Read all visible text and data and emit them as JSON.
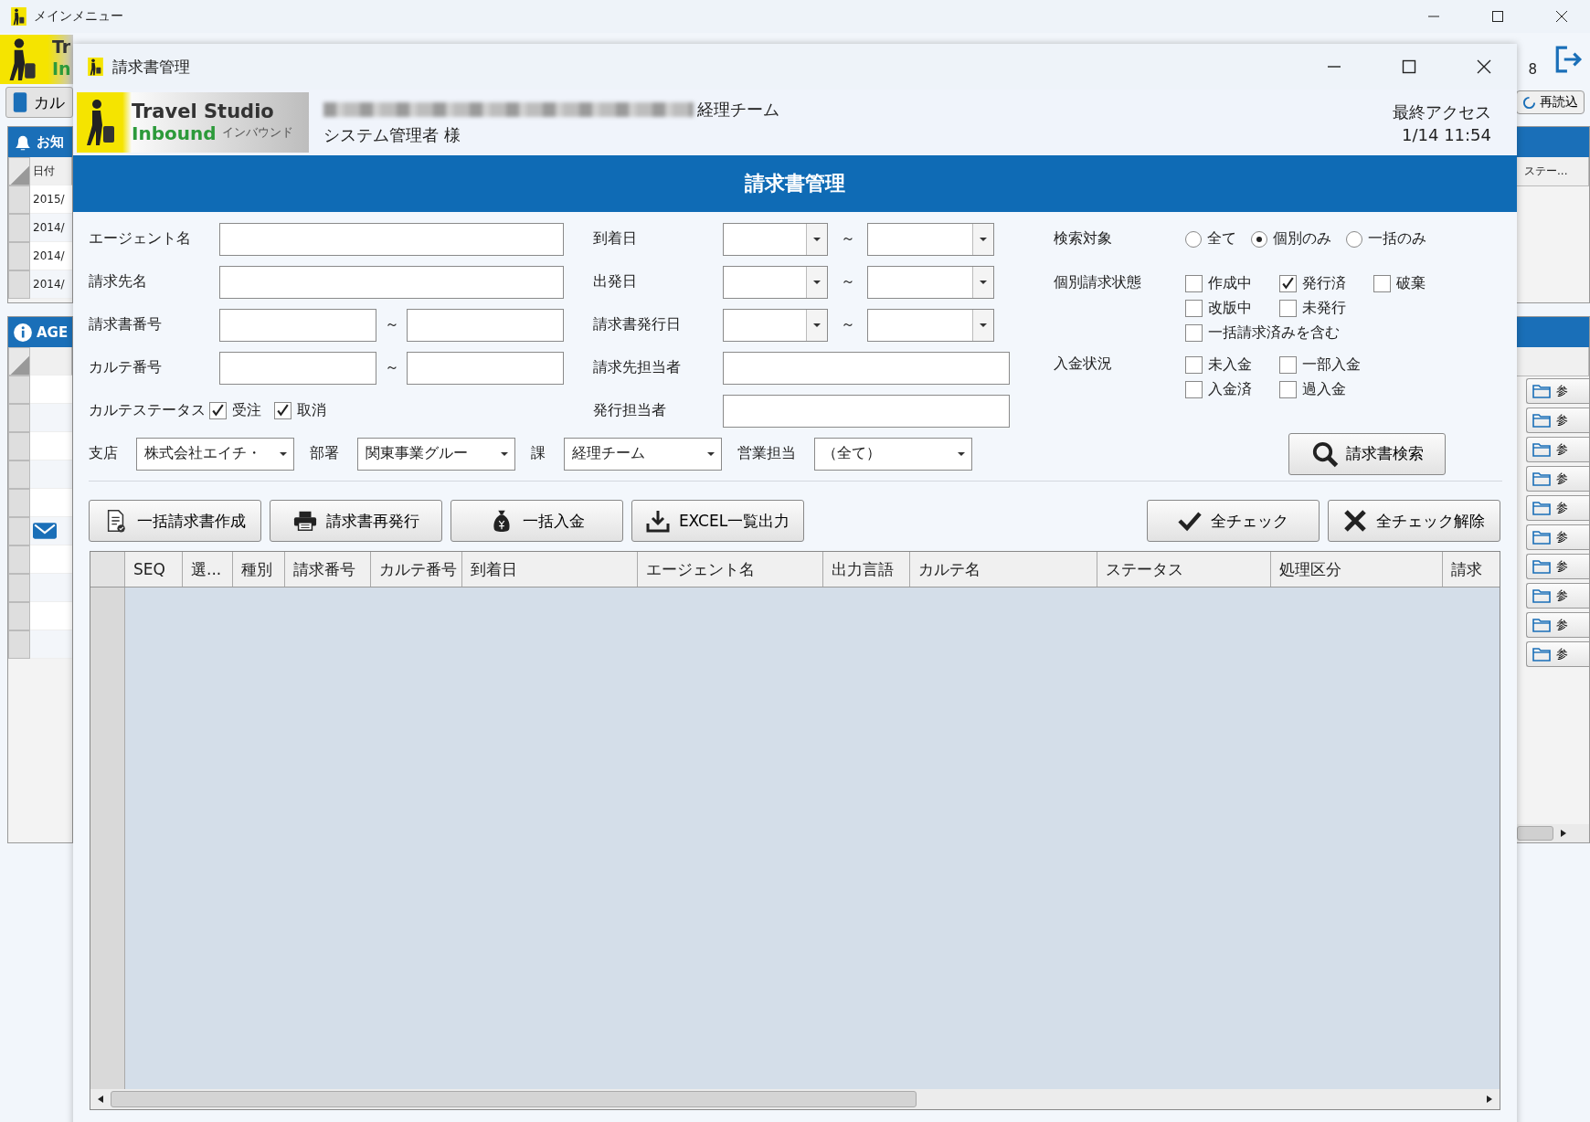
{
  "background_window": {
    "title": "メインメニュー",
    "logo_text": [
      "Tr",
      "In"
    ],
    "access_fragment": "8",
    "tab_button": "カル",
    "reload_button": "再読込",
    "notice_panel": {
      "title": "お知",
      "column": "日付",
      "rows": [
        "2015/",
        "2014/",
        "2014/",
        "2014/"
      ]
    },
    "agent_panel": {
      "title": "AGE",
      "rows": [
        {
          "has_mail": false
        },
        {
          "has_mail": false
        },
        {
          "has_mail": false
        },
        {
          "has_mail": false
        },
        {
          "has_mail": false
        },
        {
          "has_mail": true
        },
        {
          "has_mail": false
        },
        {
          "has_mail": false
        },
        {
          "has_mail": false
        },
        {
          "has_mail": false
        }
      ]
    },
    "status_column": "ステー...",
    "reference_buttons": [
      "参",
      "参",
      "参",
      "参",
      "参",
      "参",
      "参",
      "参",
      "参",
      "参"
    ]
  },
  "dialog": {
    "title": "請求書管理",
    "team": "経理チーム",
    "user": "システム管理者 様",
    "last_access_label": "最終アクセス",
    "last_access": "1/14 11:54",
    "logo": {
      "line1": "Travel Studio",
      "line2": "Inbound",
      "sub": "インバウンド"
    },
    "heading": "請求書管理",
    "left_fields": [
      {
        "label": "エージェント名",
        "kind": "text"
      },
      {
        "label": "請求先名",
        "kind": "text"
      },
      {
        "label": "請求書番号",
        "kind": "range",
        "separator": "～"
      },
      {
        "label": "カルテ番号",
        "kind": "range",
        "separator": "～"
      }
    ],
    "karte_status": {
      "label": "カルテステータス",
      "options": [
        {
          "label": "受注",
          "checked": true
        },
        {
          "label": "取消",
          "checked": true
        }
      ]
    },
    "mid_fields": [
      {
        "label": "到着日",
        "kind": "date_range",
        "separator": "～"
      },
      {
        "label": "出発日",
        "kind": "date_range",
        "separator": "～"
      },
      {
        "label": "請求書発行日",
        "kind": "date_range",
        "separator": "～"
      },
      {
        "label": "請求先担当者",
        "kind": "text"
      },
      {
        "label": "発行担当者",
        "kind": "text"
      }
    ],
    "search_target": {
      "label": "検索対象",
      "options": [
        {
          "label": "全て",
          "selected": false
        },
        {
          "label": "個別のみ",
          "selected": true
        },
        {
          "label": "一括のみ",
          "selected": false
        }
      ]
    },
    "individual_status": {
      "label": "個別請求状態",
      "option_rows": [
        [
          {
            "label": "作成中",
            "checked": false
          },
          {
            "label": "発行済",
            "checked": true
          },
          {
            "label": "破棄",
            "checked": false
          }
        ],
        [
          {
            "label": "改版中",
            "checked": false
          },
          {
            "label": "未発行",
            "checked": false
          }
        ],
        [
          {
            "label": "一括請求済みを含む",
            "checked": false
          }
        ]
      ]
    },
    "payment_status": {
      "label": "入金状況",
      "option_rows": [
        [
          {
            "label": "未入金",
            "checked": false
          },
          {
            "label": "一部入金",
            "checked": false
          }
        ],
        [
          {
            "label": "入金済",
            "checked": false
          },
          {
            "label": "過入金",
            "checked": false
          }
        ]
      ]
    },
    "combos": [
      {
        "label": "支店",
        "value": "株式会社エイチ・"
      },
      {
        "label": "部署",
        "value": "関東事業グルー"
      },
      {
        "label": "課",
        "value": "経理チーム"
      },
      {
        "label": "営業担当",
        "value": "（全て）"
      }
    ],
    "search_button": "請求書検索",
    "action_buttons": [
      {
        "label": "一括請求書作成",
        "kind": "document"
      },
      {
        "label": "請求書再発行",
        "kind": "printer"
      },
      {
        "label": "一括入金",
        "kind": "money"
      },
      {
        "label": "EXCEL一覧出力",
        "kind": "download"
      }
    ],
    "check_buttons": [
      {
        "label": "全チェック",
        "kind": "check"
      },
      {
        "label": "全チェック解除",
        "kind": "cross"
      }
    ],
    "table": {
      "columns": [
        "SEQ",
        "選...",
        "種別",
        "請求番号",
        "カルテ番号",
        "到着日",
        "エージェント名",
        "出力言語",
        "カルテ名",
        "ステータス",
        "処理区分",
        "請求"
      ]
    }
  }
}
